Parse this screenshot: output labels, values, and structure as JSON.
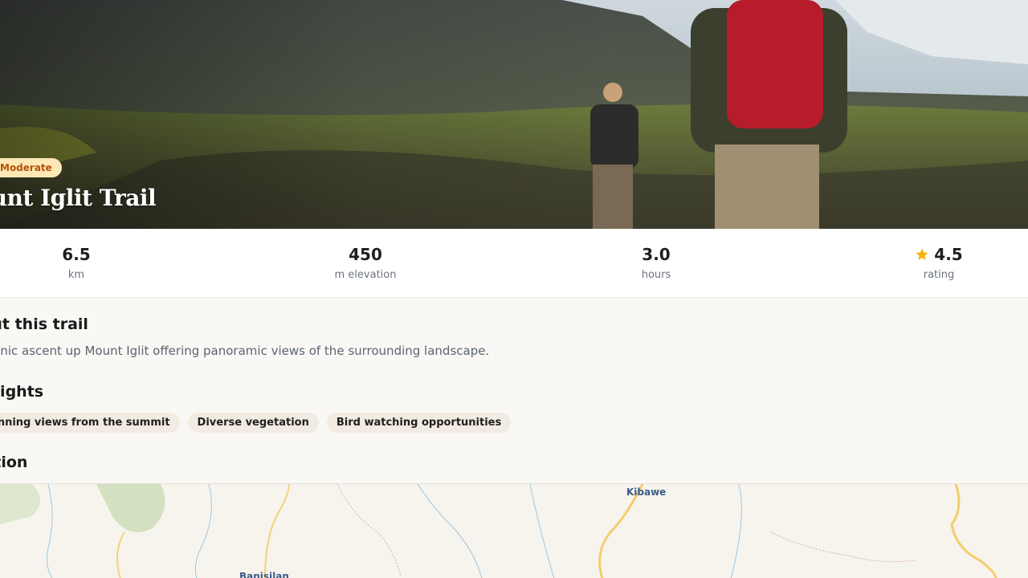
{
  "hero": {
    "difficulty": "Moderate",
    "title": "Mount Iglit Trail"
  },
  "stats": [
    {
      "value": "6.5",
      "unit": "km"
    },
    {
      "value": "450",
      "unit": "m elevation"
    },
    {
      "value": "3.0",
      "unit": "hours"
    },
    {
      "value": "4.5",
      "unit": "rating",
      "icon": "star-icon",
      "icon_color": "#f5b400"
    }
  ],
  "about": {
    "title": "About this trail",
    "text": "A scenic ascent up Mount Iglit offering panoramic views of the surrounding landscape."
  },
  "highlights": {
    "title": "Highlights",
    "items": [
      "Stunning views from the summit",
      "Diverse vegetation",
      "Bird watching opportunities"
    ]
  },
  "location": {
    "title": "Location",
    "map_labels": [
      "Kibawe",
      "Banisilan"
    ]
  }
}
